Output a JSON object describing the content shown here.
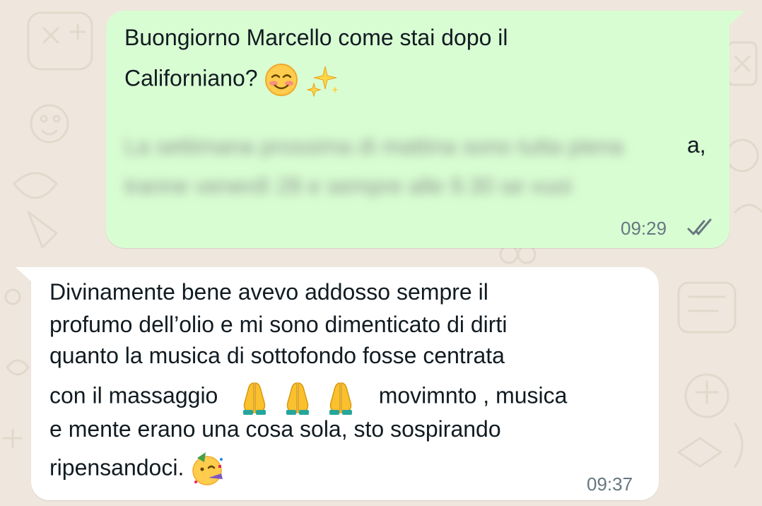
{
  "chat": {
    "outgoing": {
      "lines": [
        "Buongiorno Marcello come stai dopo il",
        "Californiano?"
      ],
      "emoji": [
        "smiling-face-with-blush",
        "sparkles"
      ],
      "blurred_lines": [
        "La settimana prossima di mattina sono tutta piena",
        "tranne venerdì 28 e sempre alle 9.30 se vuoi"
      ],
      "visible_tail": "a,",
      "time": "09:29",
      "status_icon": "double-check-icon"
    },
    "incoming": {
      "lines": [
        "Divinamente bene avevo addosso sempre il",
        "profumo dell’olio e mi sono dimenticato di dirti",
        "quanto la musica di sottofondo fosse centrata",
        "con il massaggio",
        "movimnto , musica",
        "e mente erano una cosa sola, sto sospirando",
        "ripensandoci."
      ],
      "emoji": [
        "folded-hands",
        "folded-hands",
        "folded-hands",
        "partying-face"
      ],
      "time": "09:37"
    }
  },
  "colors": {
    "background": "#efe7dd",
    "outgoing_bubble": "#d9fdd3",
    "incoming_bubble": "#ffffff",
    "text": "#111b21",
    "meta": "#667781"
  }
}
